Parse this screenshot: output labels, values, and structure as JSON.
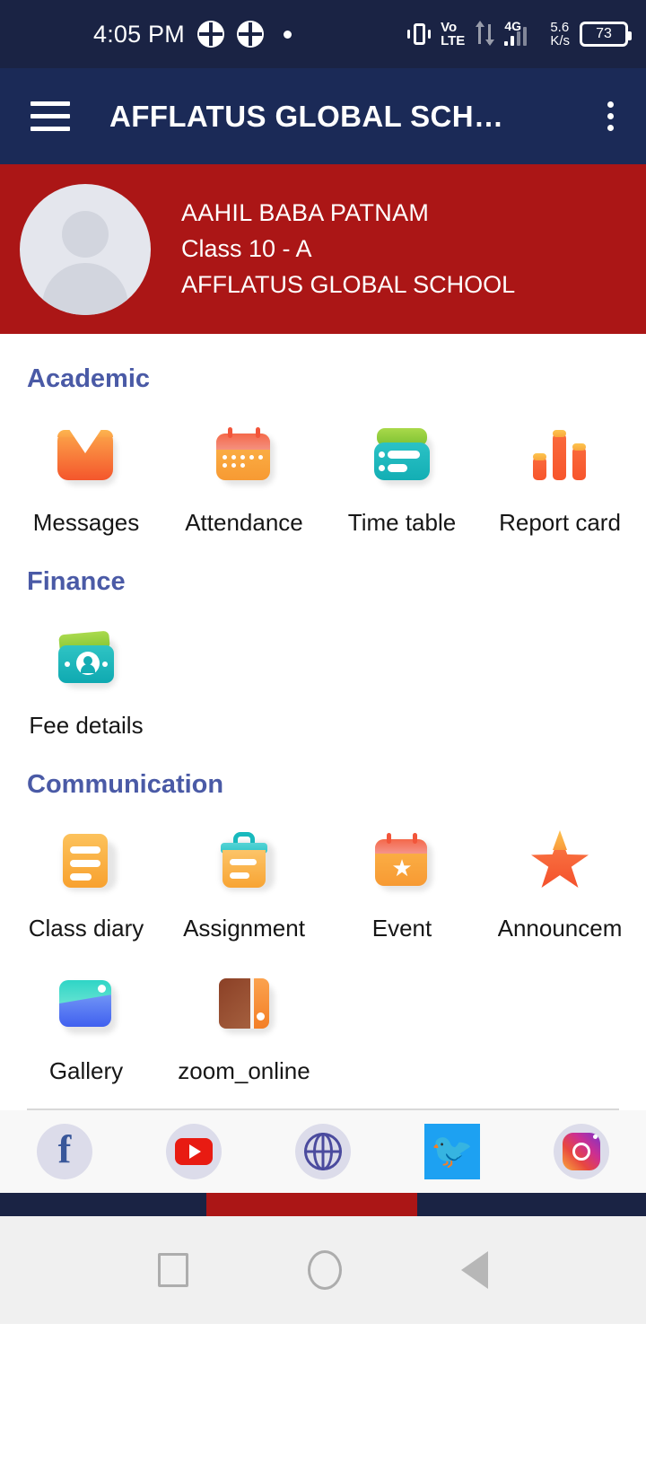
{
  "statusbar": {
    "time": "4:05 PM",
    "volte_top": "Vo",
    "volte_bottom": "LTE",
    "network": "4G",
    "speed_value": "5.6",
    "speed_unit": "K/s",
    "battery": "73",
    "icons": [
      "app-badge-icon",
      "app-badge-icon",
      "notification-dot-icon",
      "vibrate-icon",
      "volte-icon",
      "data-transfer-icon",
      "signal-icon",
      "battery-icon"
    ]
  },
  "appbar": {
    "title": "AFFLATUS GLOBAL SCH…",
    "menu_icon": "hamburger-menu-icon",
    "overflow_icon": "more-vertical-icon",
    "background": "#1b2a57"
  },
  "profile": {
    "name": "AAHIL BABA PATNAM",
    "class": "Class 10 - A",
    "school": "AFFLATUS GLOBAL SCHOOL",
    "avatar_icon": "person-placeholder-avatar",
    "background": "#ab1616"
  },
  "sections": [
    {
      "title": "Academic",
      "items": [
        {
          "label": "Messages",
          "icon": "envelope-icon"
        },
        {
          "label": "Attendance",
          "icon": "calendar-icon"
        },
        {
          "label": "Time table",
          "icon": "timetable-card-icon"
        },
        {
          "label": "Report card",
          "icon": "bar-chart-icon"
        }
      ]
    },
    {
      "title": "Finance",
      "items": [
        {
          "label": "Fee details",
          "icon": "wallet-money-icon"
        }
      ]
    },
    {
      "title": "Communication",
      "items": [
        {
          "label": "Class diary",
          "icon": "document-lines-icon"
        },
        {
          "label": "Assignment",
          "icon": "clipboard-icon"
        },
        {
          "label": "Event",
          "icon": "calendar-star-icon"
        },
        {
          "label": "Announcem",
          "icon": "star-icon"
        },
        {
          "label": "Gallery",
          "icon": "photo-gallery-icon"
        },
        {
          "label": "zoom_online",
          "icon": "book-icon"
        }
      ]
    }
  ],
  "social": [
    {
      "name": "facebook",
      "icon": "facebook-icon"
    },
    {
      "name": "youtube",
      "icon": "youtube-icon"
    },
    {
      "name": "website",
      "icon": "globe-icon"
    },
    {
      "name": "twitter",
      "icon": "twitter-icon"
    },
    {
      "name": "instagram",
      "icon": "instagram-icon"
    }
  ],
  "navbar": {
    "recent": "recents-square-icon",
    "home": "home-circle-icon",
    "back": "back-triangle-icon"
  },
  "colors": {
    "statusbar": "#1a2344",
    "appbar": "#1b2a57",
    "profile": "#ab1616",
    "section_title": "#4a5aa6",
    "twitter": "#1da1f2",
    "youtube": "#e81b12"
  }
}
